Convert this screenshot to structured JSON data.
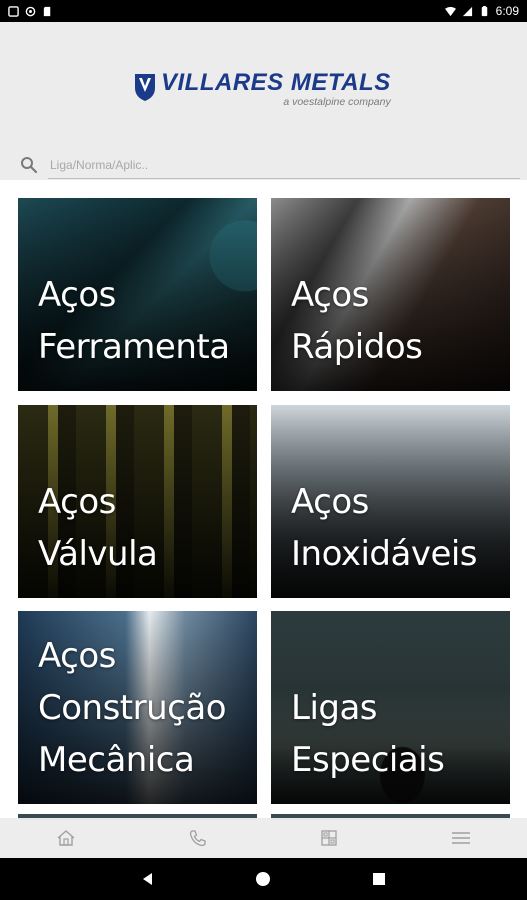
{
  "status_bar": {
    "time": "6:09"
  },
  "header": {
    "brand": "VILLARES METALS",
    "tagline": "a voestalpine company",
    "brand_color": "#1b3a8a"
  },
  "search": {
    "placeholder": "Liga/Norma/Aplic..",
    "value": ""
  },
  "tiles": [
    {
      "lines": [
        "Aços",
        "Ferramenta"
      ]
    },
    {
      "lines": [
        "Aços",
        "Rápidos"
      ]
    },
    {
      "lines": [
        "Aços",
        "Válvula"
      ]
    },
    {
      "lines": [
        "Aços",
        "Inoxidáveis"
      ]
    },
    {
      "lines": [
        "Aços",
        "Construção",
        "Mecânica"
      ]
    },
    {
      "lines": [
        "Ligas",
        "Especiais"
      ]
    }
  ],
  "bottom_bar": {
    "icons": [
      "home-icon",
      "phone-icon",
      "grid-icon",
      "menu-icon"
    ]
  },
  "nav_bar": {
    "icons": [
      "back-icon",
      "home-circle-icon",
      "recents-icon"
    ]
  }
}
